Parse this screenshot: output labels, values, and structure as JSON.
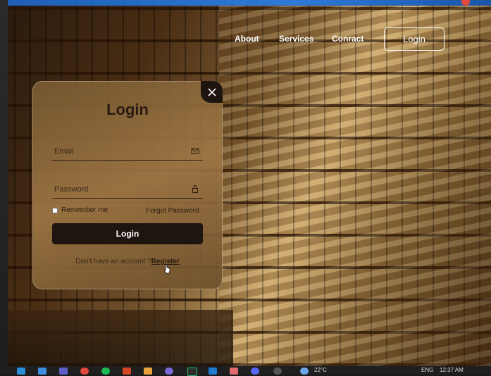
{
  "nav": {
    "about": "About",
    "services": "Services",
    "contact": "Conract",
    "login": "Login"
  },
  "modal": {
    "title": "Login",
    "email_placeholder": "Email",
    "password_placeholder": "Password",
    "remember_label": "Remember me",
    "forgot_label": "Forgot Password",
    "submit_label": "Login",
    "no_account_text": "Don't have an account ?",
    "register_label": "Register"
  },
  "taskbar": {
    "temperature": "22°C",
    "language": "ENG",
    "time": "12:37 AM",
    "apps": [
      "edge-icon",
      "explorer-icon",
      "teams-icon",
      "chrome-icon",
      "spotify-icon",
      "office-icon",
      "files-icon",
      "app-icon",
      "intellij-icon",
      "vscode-icon",
      "photos-icon",
      "discord-icon"
    ]
  },
  "colors": {
    "accent_dark": "#1e1410",
    "title_text": "#2a1a10",
    "topbar_blue": "#2f7ad6"
  }
}
